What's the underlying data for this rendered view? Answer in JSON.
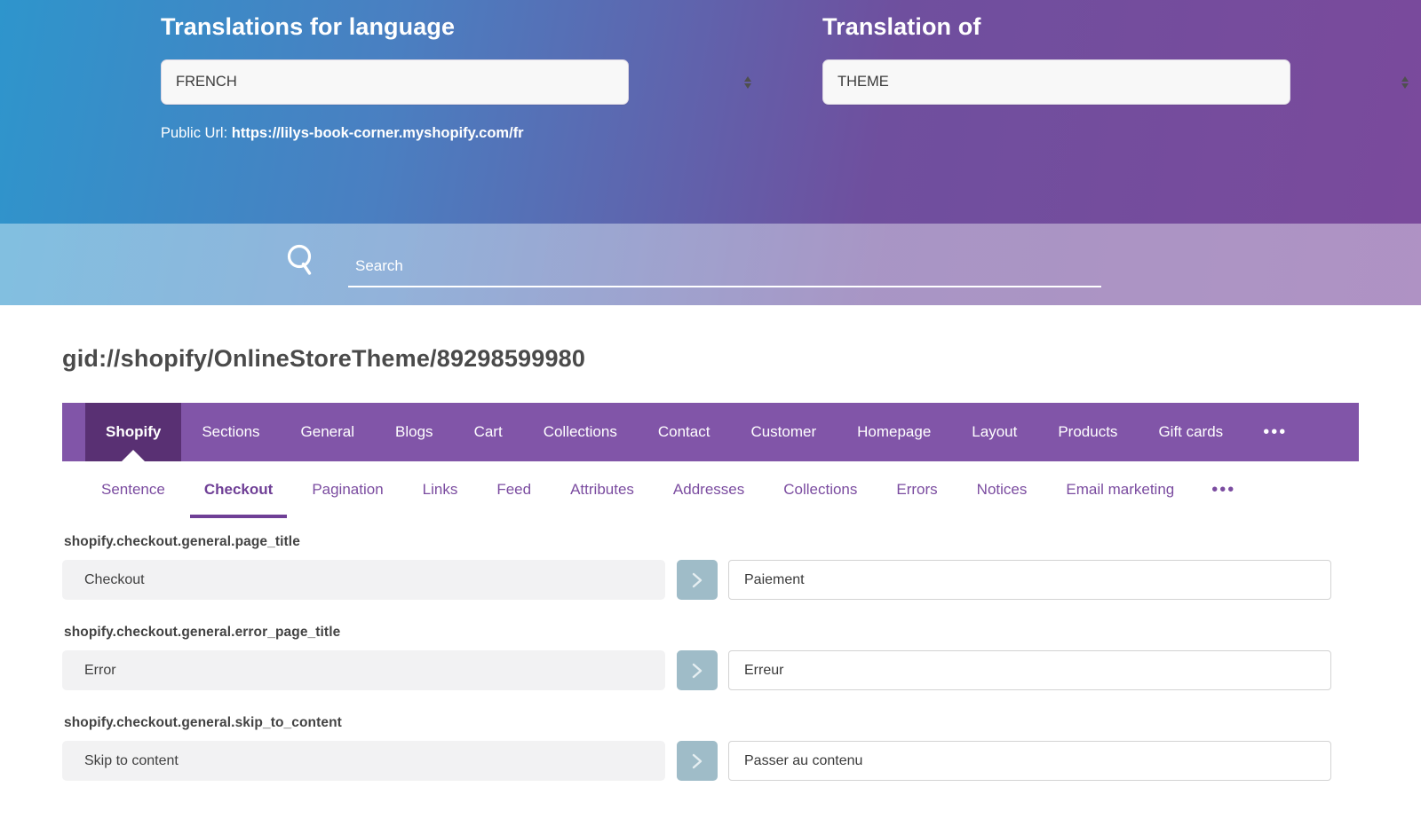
{
  "hero": {
    "left": {
      "label": "Translations for language",
      "select_value": "FRENCH",
      "public_url_prefix": "Public Url: ",
      "public_url": "https://lilys-book-corner.myshopify.com/fr"
    },
    "right": {
      "label": "Translation of",
      "select_value": "THEME"
    }
  },
  "search": {
    "placeholder": "Search",
    "value": "",
    "icon": "search-icon"
  },
  "page": {
    "title": "gid://shopify/OnlineStoreTheme/89298599980"
  },
  "tabs_primary": {
    "items": [
      {
        "label": "Shopify",
        "active": true
      },
      {
        "label": "Sections",
        "active": false
      },
      {
        "label": "General",
        "active": false
      },
      {
        "label": "Blogs",
        "active": false
      },
      {
        "label": "Cart",
        "active": false
      },
      {
        "label": "Collections",
        "active": false
      },
      {
        "label": "Contact",
        "active": false
      },
      {
        "label": "Customer",
        "active": false
      },
      {
        "label": "Homepage",
        "active": false
      },
      {
        "label": "Layout",
        "active": false
      },
      {
        "label": "Products",
        "active": false
      },
      {
        "label": "Gift cards",
        "active": false
      }
    ],
    "overflow_label": "•••"
  },
  "tabs_secondary": {
    "items": [
      {
        "label": "Sentence",
        "active": false
      },
      {
        "label": "Checkout",
        "active": true
      },
      {
        "label": "Pagination",
        "active": false
      },
      {
        "label": "Links",
        "active": false
      },
      {
        "label": "Feed",
        "active": false
      },
      {
        "label": "Attributes",
        "active": false
      },
      {
        "label": "Addresses",
        "active": false
      },
      {
        "label": "Collections",
        "active": false
      },
      {
        "label": "Errors",
        "active": false
      },
      {
        "label": "Notices",
        "active": false
      },
      {
        "label": "Email marketing",
        "active": false
      }
    ],
    "overflow_label": "•••"
  },
  "rows": [
    {
      "key": "shopify.checkout.general.page_title",
      "source": "Checkout",
      "translation": "Paiement"
    },
    {
      "key": "shopify.checkout.general.error_page_title",
      "source": "Error",
      "translation": "Erreur"
    },
    {
      "key": "shopify.checkout.general.skip_to_content",
      "source": "Skip to content",
      "translation": "Passer au contenu"
    }
  ],
  "colors": {
    "gradient_start": "#2e95cc",
    "gradient_end": "#7a4a9c",
    "primary_tab_bar": "#8155a8",
    "active_primary_tab": "#593073",
    "secondary_tab_text": "#7b4ca0",
    "arrow_button": "#9fbcc8",
    "source_field_bg": "#f2f2f3"
  }
}
